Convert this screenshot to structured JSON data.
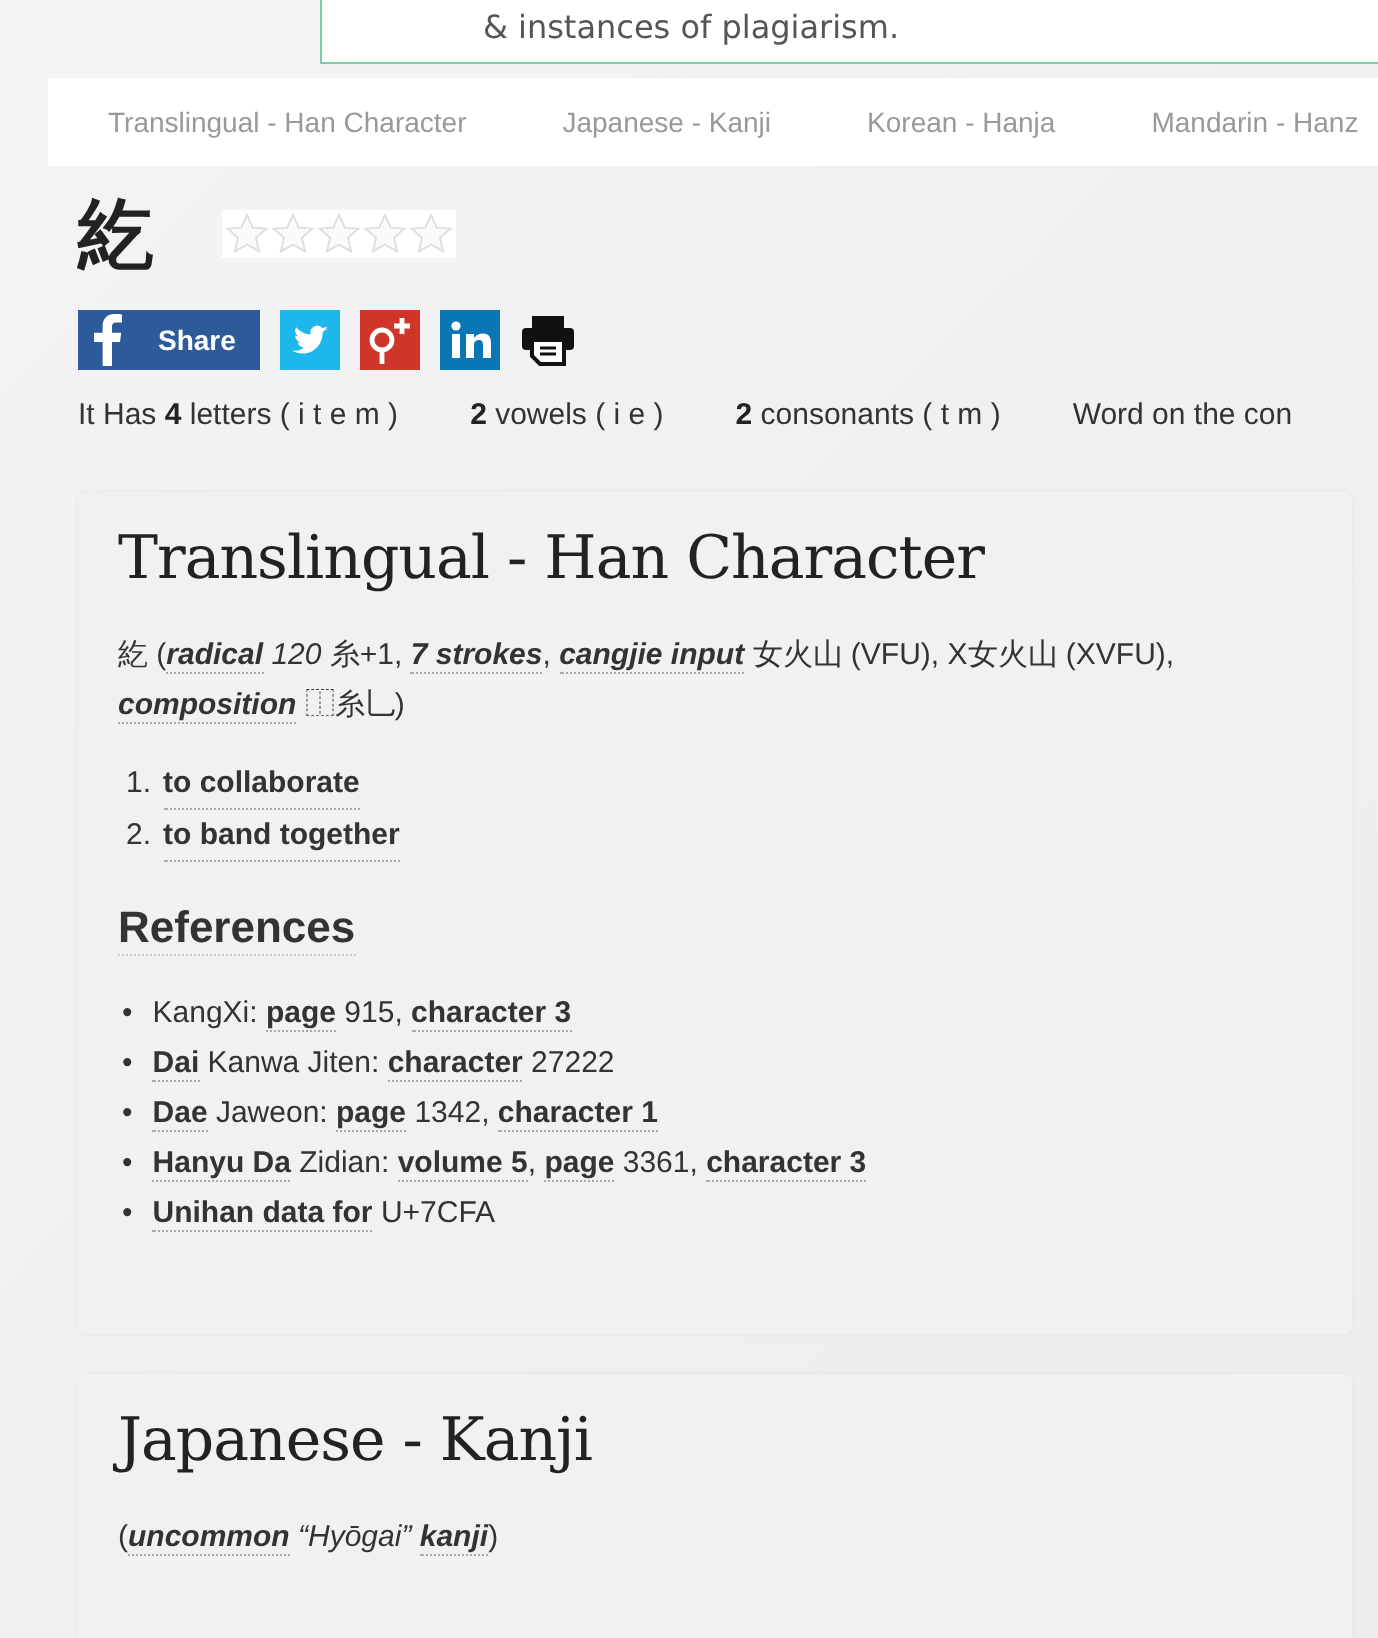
{
  "banner": {
    "text": "& instances of plagiarism."
  },
  "tabs": [
    {
      "label": "Translingual - Han Character",
      "selected": false
    },
    {
      "label": "Japanese - Kanji",
      "selected": false
    },
    {
      "label": "Korean - Hanja",
      "selected": false
    },
    {
      "label": "Mandarin - Hanz",
      "selected": false
    }
  ],
  "word": {
    "character": "紇",
    "stars": 0
  },
  "share": {
    "facebook_label": "Share"
  },
  "stats": [
    "It Has **4** letters ( i t e m )",
    "**2** vowels ( i e )",
    "**2** consonants ( t m )",
    "Word on the con"
  ],
  "sections": [
    {
      "title": "Translingual - Han Character",
      "intro": "紇 (**radical** *120* 糸+1, **7 strokes**, **cangjie input** 女火山 (VFU), X女火山 (XVFU), **composition** ⿰糸乚)",
      "definitions": [
        {
          "number": "1.",
          "text": "to collaborate"
        },
        {
          "number": "2.",
          "text": "to band together"
        }
      ],
      "references_title": "References",
      "references": [
        {
          "bullet": "•",
          "text": "KangXi: **page** 915, **character 3**"
        },
        {
          "bullet": "•",
          "text": "**Dai** Kanwa Jiten: **character** 27222"
        },
        {
          "bullet": "•",
          "text": "**Dae** Jaweon: **page** 1342, **character 1**"
        },
        {
          "bullet": "•",
          "text": "**Hanyu Da** Zidian: **volume 5**, **page** 3361, **character 3**"
        },
        {
          "bullet": "•",
          "text": "**Unihan data for** U+7CFA"
        }
      ]
    },
    {
      "title": "Japanese - Kanji",
      "intro": "(**uncommon** *“Hyōgai”* **kanji**)"
    }
  ]
}
